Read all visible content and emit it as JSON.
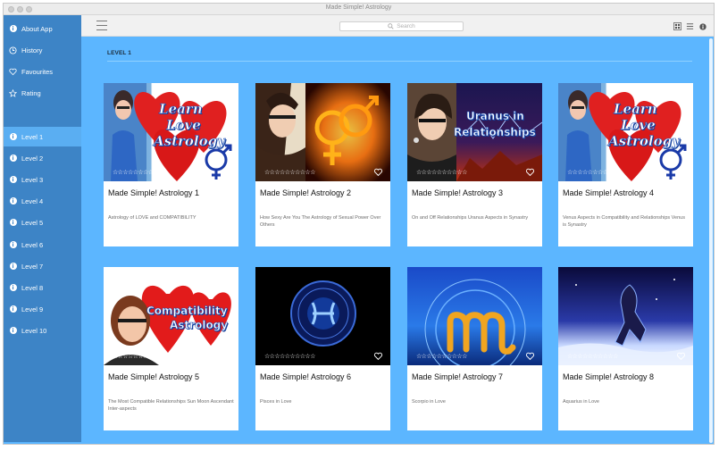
{
  "window": {
    "title": "Made Simple! Astrology"
  },
  "sidebar": {
    "top_items": [
      {
        "label": "About App",
        "icon": "info-icon"
      },
      {
        "label": "History",
        "icon": "clock-icon"
      },
      {
        "label": "Favourites",
        "icon": "heart-icon"
      },
      {
        "label": "Rating",
        "icon": "star-icon"
      }
    ],
    "levels": [
      {
        "label": "Level 1",
        "active": true
      },
      {
        "label": "Level 2"
      },
      {
        "label": "Level 3"
      },
      {
        "label": "Level 4"
      },
      {
        "label": "Level 5"
      },
      {
        "label": "Level 6"
      },
      {
        "label": "Level 7"
      },
      {
        "label": "Level 8"
      },
      {
        "label": "Level 9"
      },
      {
        "label": "Level 10"
      }
    ]
  },
  "toolbar": {
    "search_placeholder": "Search"
  },
  "main": {
    "level_title": "LEVEL 1",
    "cards": [
      {
        "title": "Made Simple! Astrology 1",
        "desc": "Astrology of LOVE and COMPATIBILITY",
        "thumb_text": [
          "Learn",
          "Love",
          "Astrology"
        ],
        "stars": "☆☆☆☆☆☆☆☆☆☆"
      },
      {
        "title": "Made Simple! Astrology 2",
        "desc": "How Sexy Are You The Astrology of Sexual Power Over Others",
        "stars": "☆☆☆☆☆☆☆☆☆☆"
      },
      {
        "title": "Made Simple! Astrology 3",
        "desc": "On and Off Relationships Uranus Aspects in Synastry",
        "thumb_text": [
          "Uranus in",
          "Relationships"
        ],
        "stars": "☆☆☆☆☆☆☆☆☆☆"
      },
      {
        "title": "Made Simple! Astrology 4",
        "desc": "Venus Aspects in Compatibility and Relationships Venus is Synastry",
        "thumb_text": [
          "Learn",
          "Love",
          "Astrology"
        ],
        "stars": "☆☆☆☆☆☆☆☆☆☆"
      },
      {
        "title": "Made Simple! Astrology 5",
        "desc": "The Most Compatible Relationships Sun Moon Ascendant Inter-aspects",
        "thumb_text": [
          "Compatibility",
          "Astrology"
        ],
        "stars": "☆☆☆☆☆☆☆☆☆☆"
      },
      {
        "title": "Made Simple! Astrology 6",
        "desc": "Pisces in Love",
        "stars": "☆☆☆☆☆☆☆☆☆☆"
      },
      {
        "title": "Made Simple! Astrology 7",
        "desc": "Scorpio in Love",
        "stars": "☆☆☆☆☆☆☆☆☆☆"
      },
      {
        "title": "Made Simple! Astrology 8",
        "desc": "Aquarius in Love",
        "stars": "☆☆☆☆☆☆☆☆☆☆"
      }
    ]
  },
  "colors": {
    "sidebar": "#3d84c6",
    "active_item": "#5aaef2",
    "content_bg": "#5cb6ff"
  }
}
